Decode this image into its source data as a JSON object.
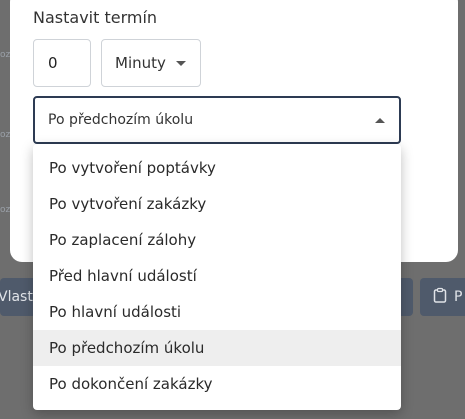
{
  "background": {
    "left_button_label": "Vlast",
    "right_button_label": "P",
    "left_strip_labels": [
      "oz",
      "oz",
      "oz"
    ]
  },
  "modal": {
    "title": "Nastavit termín",
    "amount_value": "0",
    "unit_selected": "Minuty",
    "trigger_selected": "Po předchozím úkolu"
  },
  "dropdown": {
    "options": [
      {
        "label": "Po vytvoření poptávky"
      },
      {
        "label": "Po vytvoření zakázky"
      },
      {
        "label": "Po zaplacení zálohy"
      },
      {
        "label": "Před hlavní událostí"
      },
      {
        "label": "Po hlavní události"
      },
      {
        "label": "Po předchozím úkolu"
      },
      {
        "label": "Po dokončení zakázky"
      }
    ],
    "selected_index": 5
  },
  "colors": {
    "backdrop": "#6e6e6e",
    "accent_border": "#2d3b53",
    "selected_row": "#eeeeee",
    "bg_button": "#4f5a6b"
  }
}
